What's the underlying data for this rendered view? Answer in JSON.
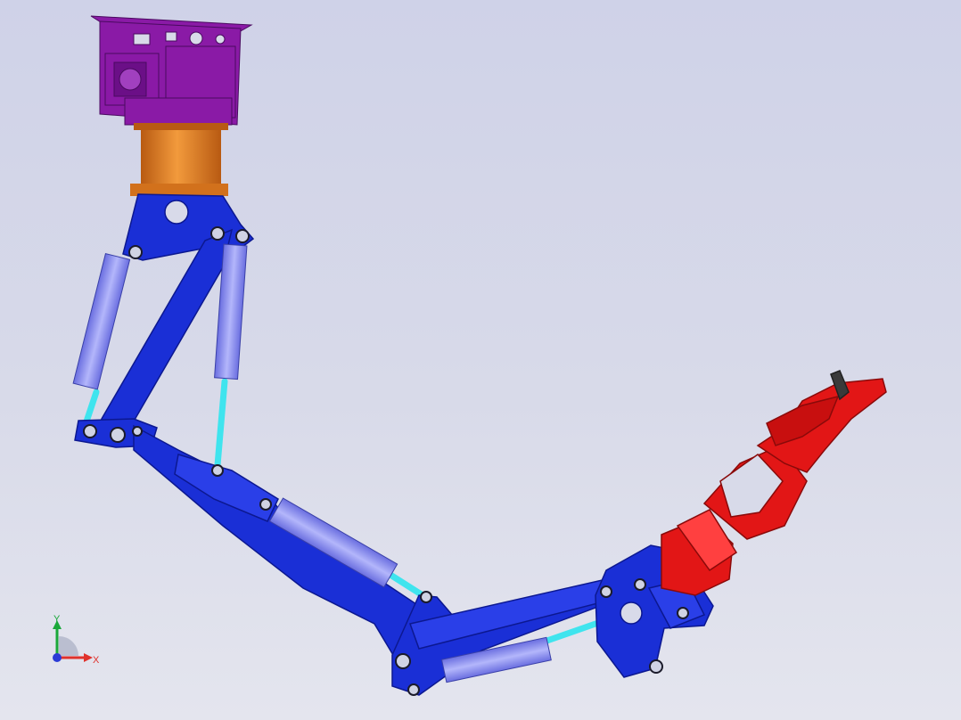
{
  "viewport": {
    "background_top": "#cfd2e8",
    "background_bottom": "#e4e5ee"
  },
  "triad": {
    "x_label": "X",
    "y_label": "Y",
    "x_color": "#e0322c",
    "y_color": "#1aa83a",
    "z_color": "#2b3bd6"
  },
  "model": {
    "colors": {
      "mount_bracket": "#8a1aa6",
      "rotary_base": "#e07a1e",
      "arm_links": "#1a2fd6",
      "hydraulic_cylinders": "#8c8ff0",
      "piston_rods": "#3fe4ee",
      "gripper": "#e21616"
    },
    "parts": [
      "mount-bracket",
      "rotary-base",
      "shoulder-link",
      "upper-arm",
      "forearm",
      "wrist",
      "gripper"
    ]
  }
}
